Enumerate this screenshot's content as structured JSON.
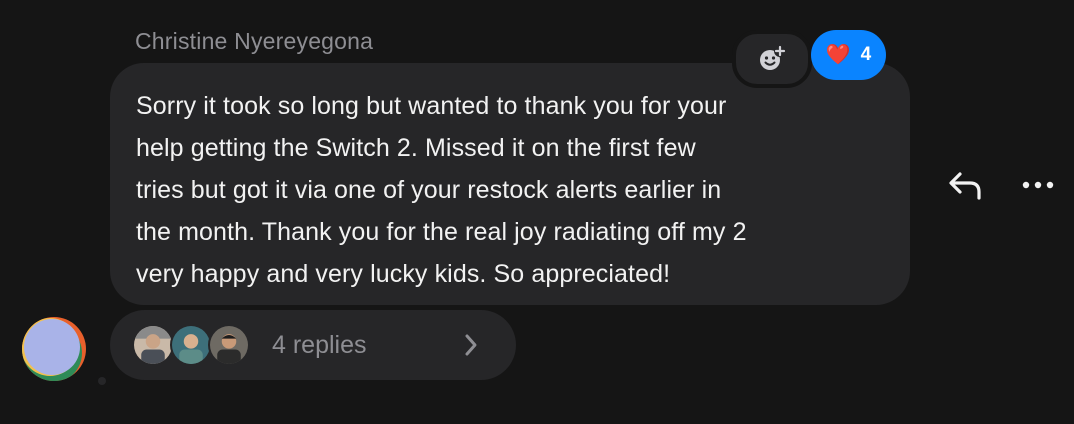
{
  "message": {
    "sender_name": "Christine Nyereyegona",
    "text_lines": [
      "Sorry it took so long but wanted to thank you for your",
      "help getting the Switch 2. Missed it on the first few",
      "tries but got it via one of your restock alerts earlier in",
      "the month. Thank you for the real joy radiating off my 2",
      "very happy and very lucky kids. So appreciated!"
    ]
  },
  "reactions": {
    "add_icon": "add-emoji-icon",
    "heart": {
      "emoji": "❤️",
      "count": "4"
    }
  },
  "actions": {
    "reply_icon": "reply-arrow-icon",
    "more_icon": "more-horizontal-icon"
  },
  "thread": {
    "replies_label": "4 replies",
    "reply_avatars": [
      "avatar-1",
      "avatar-2",
      "avatar-3"
    ]
  },
  "colors": {
    "background": "#151515",
    "bubble": "#262628",
    "accent_blue": "#0a84ff",
    "text_primary": "#f2f2f2",
    "text_secondary": "#8e8e93"
  }
}
